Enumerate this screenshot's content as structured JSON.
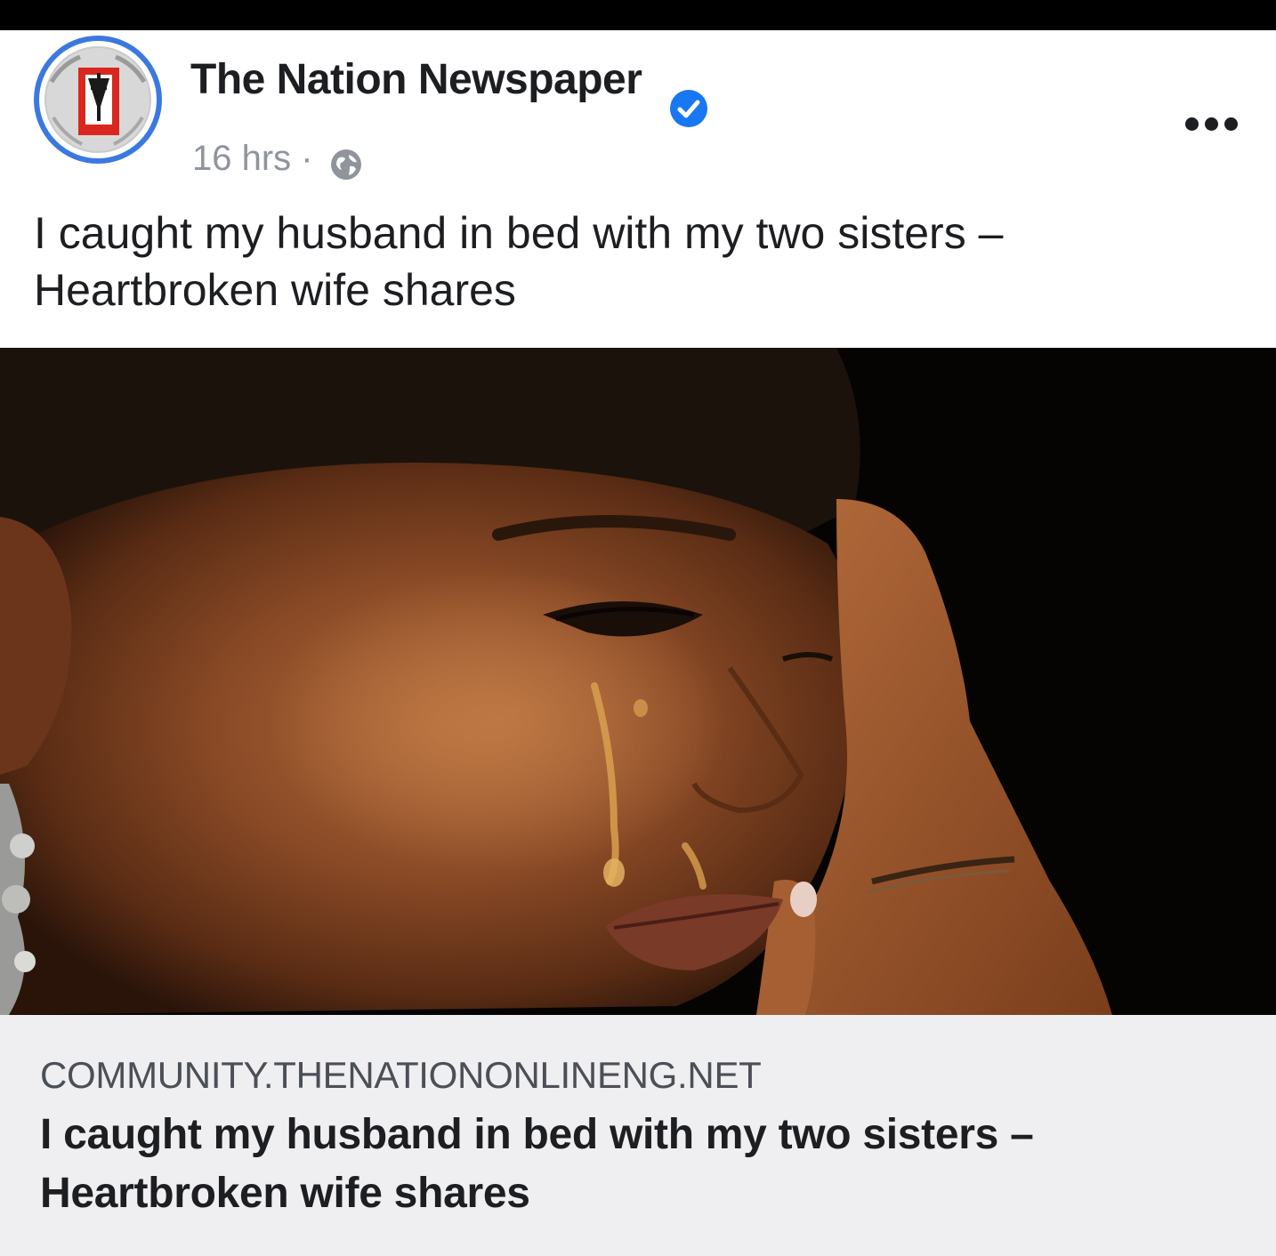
{
  "post": {
    "page_name": "The Nation Newspaper",
    "timestamp": "16 hrs",
    "separator": "·",
    "privacy_icon": "globe-icon",
    "verified_icon": "verified-badge-icon",
    "more_icon": "more-options-icon",
    "caption": "I caught my husband in bed with my two sisters – Heartbroken wife shares"
  },
  "link_preview": {
    "domain": "COMMUNITY.THENATIONONLINENG.NET",
    "title": "I caught my husband in bed with my two sisters – Heartbroken wife shares"
  },
  "colors": {
    "verified_blue": "#1877f2",
    "avatar_ring": "#3b79e0",
    "link_box_bg": "#efeef1",
    "text_primary": "#1c1e21",
    "text_secondary": "#90949c"
  }
}
